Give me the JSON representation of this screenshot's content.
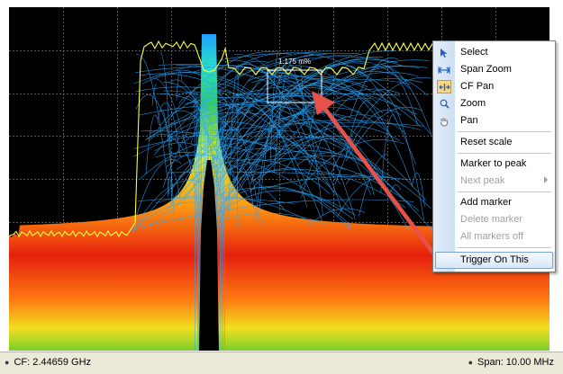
{
  "plot": {
    "annotation": "1.175 m%"
  },
  "status": {
    "cf": "CF: 2.44659 GHz",
    "span": "Span: 10.00 MHz"
  },
  "context_menu": {
    "items": [
      {
        "label": "Select",
        "icon": "cursor-arrow-icon",
        "enabled": true
      },
      {
        "label": "Span Zoom",
        "icon": "span-zoom-icon",
        "enabled": true
      },
      {
        "label": "CF Pan",
        "icon": "cf-pan-icon",
        "enabled": true,
        "active": true
      },
      {
        "label": "Zoom",
        "icon": "zoom-magnifier-icon",
        "enabled": true
      },
      {
        "label": "Pan",
        "icon": "hand-pan-icon",
        "enabled": true
      },
      {
        "label": "Reset scale",
        "enabled": true
      },
      {
        "label": "Marker to peak",
        "enabled": true
      },
      {
        "label": "Next peak",
        "enabled": false,
        "submenu": true
      },
      {
        "label": "Add marker",
        "enabled": true
      },
      {
        "label": "Delete marker",
        "enabled": false
      },
      {
        "label": "All markers off",
        "enabled": false
      },
      {
        "label": "Trigger On This",
        "enabled": true,
        "highlighted": true
      }
    ]
  },
  "colors": {
    "trace": "#2aa8ff",
    "envelope": "#ffff40",
    "arrow": "#e8504a",
    "background": "#000000"
  }
}
